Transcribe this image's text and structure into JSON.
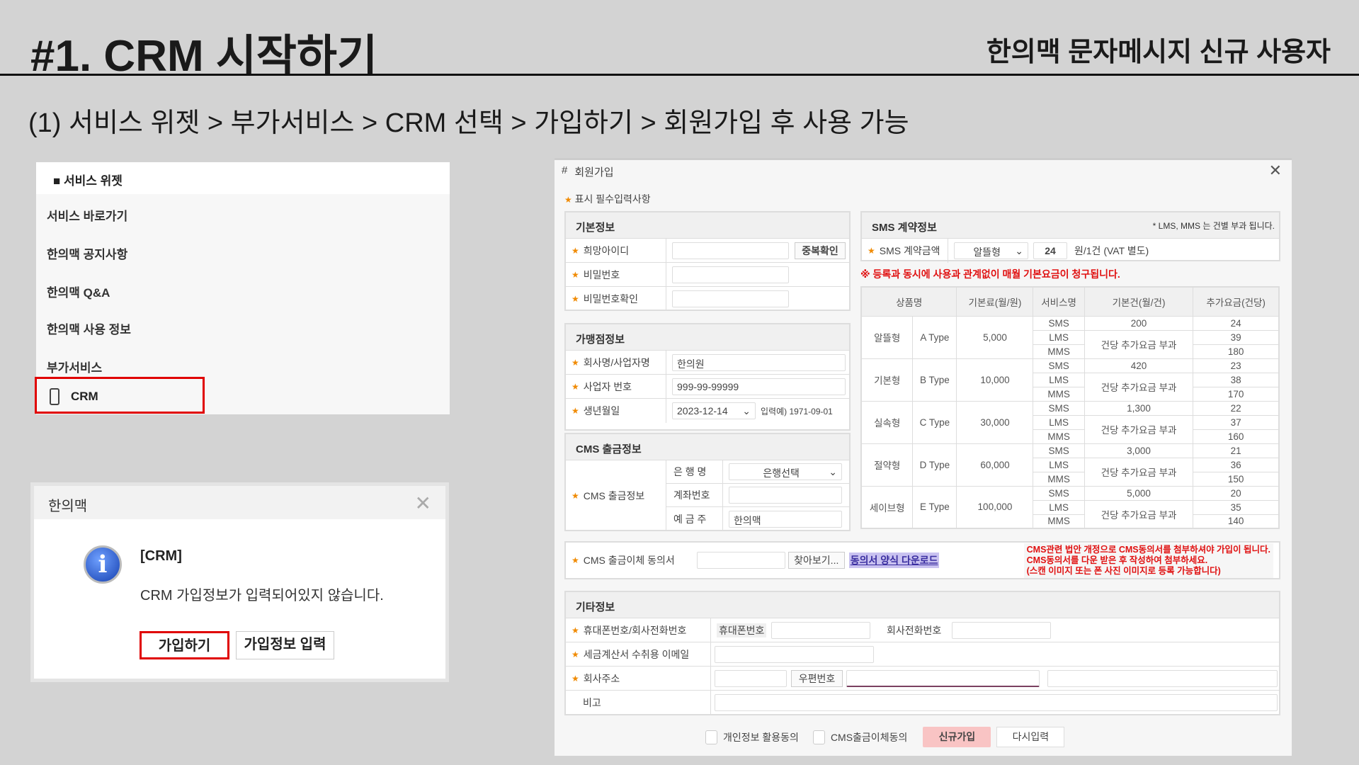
{
  "header": {
    "title": "#1. CRM 시작하기",
    "subtitle": "한의맥 문자메시지 신규 사용자",
    "steps": "(1) 서비스 위젯 > 부가서비스 > CRM 선택 > 가입하기 > 회원가입 후 사용 가능"
  },
  "widget": {
    "title": "■ 서비스 위젯",
    "items": [
      "서비스 바로가기",
      "한의맥 공지사항",
      "한의맥 Q&A",
      "한의맥 사용 정보",
      "부가서비스"
    ],
    "crm": "CRM"
  },
  "dialog": {
    "title": "한의맥",
    "close": "✕",
    "heading": "[CRM]",
    "message": "CRM 가입정보가 입력되어있지 않습니다.",
    "join": "가입하기",
    "enter_info": "가입정보 입력"
  },
  "form": {
    "title": "회원가입",
    "close": "✕",
    "required_note": "표시 필수입력사항",
    "basic": {
      "header": "기본정보",
      "id_label": "희망아이디",
      "dup_check": "중복확인",
      "pw_label": "비밀번호",
      "pw_confirm_label": "비밀번호확인"
    },
    "store": {
      "header": "가맹점정보",
      "company_label": "회사명/사업자명",
      "company_value": "한의원",
      "bizno_label": "사업자 번호",
      "bizno_value": "999-99-99999",
      "birth_label": "생년월일",
      "birth_value": "2023-12-14",
      "birth_hint": "입력예) 1971-09-01"
    },
    "cms": {
      "header": "CMS 출금정보",
      "label": "CMS 출금정보",
      "bank_label": "은 행 명",
      "bank_value": "은행선택",
      "account_label": "계좌번호",
      "holder_label": "예 금 주",
      "holder_value": "한의맥"
    },
    "sms": {
      "header": "SMS 계약정보",
      "note": "* LMS, MMS 는 건별 부과 됩니다.",
      "amount_label": "SMS 계약금액",
      "plan_value": "알뜰형",
      "price_value": "24",
      "price_unit": "원/1건 (VAT 별도)",
      "warning": "※ 등록과 동시에 사용과 관계없이 매월 기본요금이 청구됩니다."
    },
    "table": {
      "headers": [
        "상품명",
        "기본료(월/원)",
        "서비스명",
        "기본건(월/건)",
        "추가요금(건당)"
      ],
      "services": [
        "SMS",
        "LMS",
        "MMS"
      ],
      "extra_note": "건당 추가요금 부과",
      "plans": [
        {
          "name": "알뜰형",
          "type": "A Type",
          "fee": "5,000",
          "sms_count": "200",
          "rates": [
            "24",
            "39",
            "180"
          ]
        },
        {
          "name": "기본형",
          "type": "B Type",
          "fee": "10,000",
          "sms_count": "420",
          "rates": [
            "23",
            "38",
            "170"
          ]
        },
        {
          "name": "실속형",
          "type": "C Type",
          "fee": "30,000",
          "sms_count": "1,300",
          "rates": [
            "22",
            "37",
            "160"
          ]
        },
        {
          "name": "절약형",
          "type": "D Type",
          "fee": "60,000",
          "sms_count": "3,000",
          "rates": [
            "21",
            "36",
            "150"
          ]
        },
        {
          "name": "세이브형",
          "type": "E Type",
          "fee": "100,000",
          "sms_count": "5,000",
          "rates": [
            "20",
            "35",
            "140"
          ]
        }
      ]
    },
    "agreement": {
      "label": "CMS 출금이체 동의서",
      "browse": "찾아보기...",
      "download": "동의서 양식 다운로드",
      "notice": [
        "CMS관련 법안 개정으로 CMS동의서를 첨부하셔야 가입이 됩니다.",
        "CMS동의서를 다운 받은 후 작성하여 첨부하세요.",
        "(스캔 이미지 또는 폰 사진 이미지로 등록 가능합니다)"
      ]
    },
    "etc": {
      "header": "기타정보",
      "phone_label": "휴대폰번호/회사전화번호",
      "mobile": "휴대폰번호",
      "office": "회사전화번호",
      "email_label": "세금계산서 수취용 이메일",
      "address_label": "회사주소",
      "zip": "우편번호",
      "memo_label": "비고"
    },
    "footer": {
      "privacy": "개인정보 활용동의",
      "cms_consent": "CMS출금이체동의",
      "submit": "신규가입",
      "reset": "다시입력"
    }
  },
  "colors": {
    "highlight": "#e00000",
    "submit_bg": "#f9c4c4",
    "required_star": "#f08a00"
  }
}
